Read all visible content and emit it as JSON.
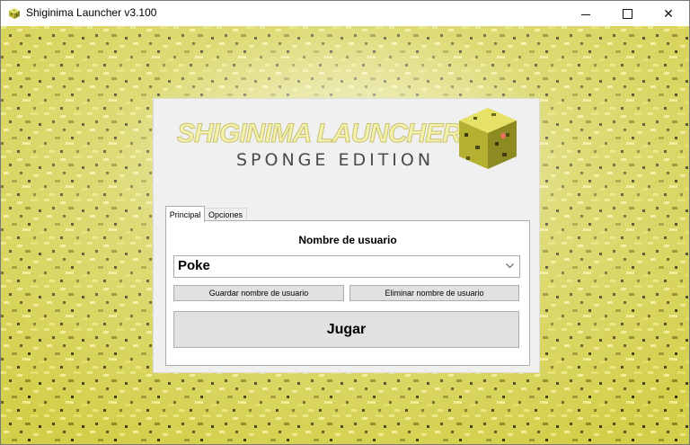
{
  "window": {
    "title": "Shiginima Launcher v3.100",
    "controls": {
      "minimize": "minimize",
      "maximize": "maximize",
      "close": "✕"
    }
  },
  "logo": {
    "line1": "SHIGINIMA LAUNCHER",
    "line2": "SPONGE EDITION"
  },
  "tabs": [
    {
      "label": "Principal",
      "active": true
    },
    {
      "label": "Opciones",
      "active": false
    }
  ],
  "main": {
    "username_label": "Nombre de usuario",
    "username_value": "Poke",
    "save_button": "Guardar nombre de usuario",
    "remove_button": "Eliminar nombre de usuario",
    "play_button": "Jugar"
  },
  "colors": {
    "sponge_light": "#e8e66a",
    "sponge_mid": "#c8c43a",
    "sponge_dark": "#4a4a12",
    "panel_bg": "#f0f0f0"
  }
}
